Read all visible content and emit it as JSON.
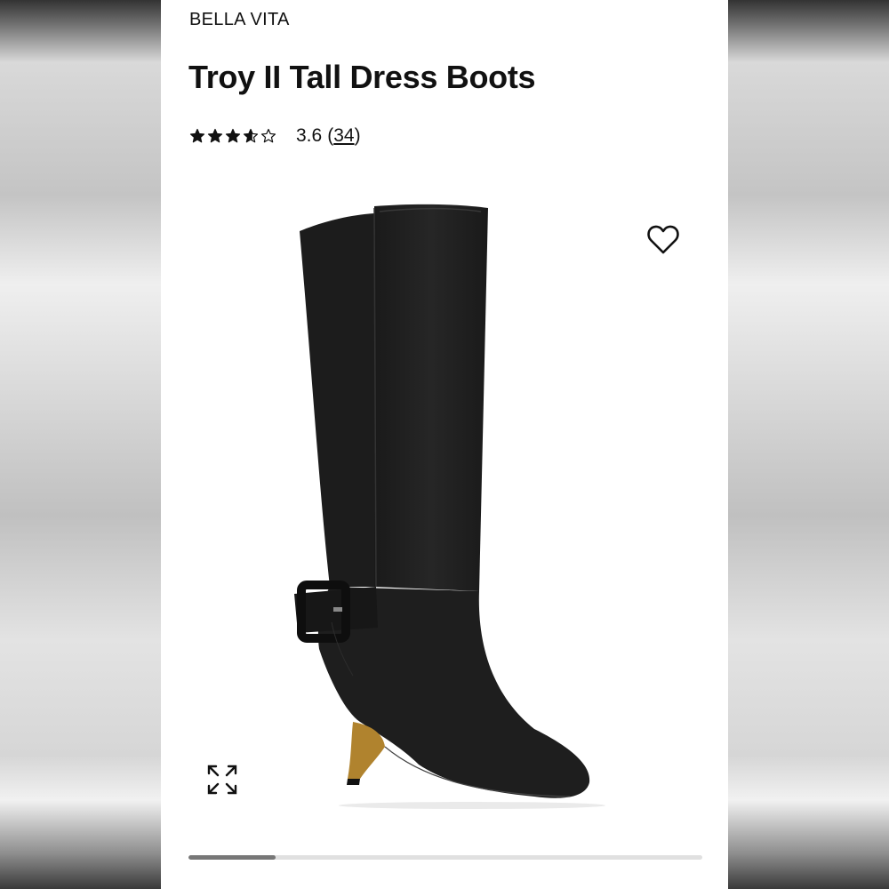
{
  "product": {
    "brand": "BELLA VITA",
    "title": "Troy II Tall Dress Boots",
    "rating": {
      "value": "3.6",
      "stars_out_of_5": 3.6,
      "open_paren": "(",
      "count": "34",
      "close_paren": ")"
    }
  },
  "icons": {
    "wishlist": "heart-outline-icon",
    "expand": "expand-arrows-icon",
    "star": "star-icon"
  },
  "carousel": {
    "progress": 0.17
  },
  "colors": {
    "text": "#111111",
    "track": "#e0e0e0",
    "indicator": "#777777",
    "product": "#1e1e1e"
  }
}
